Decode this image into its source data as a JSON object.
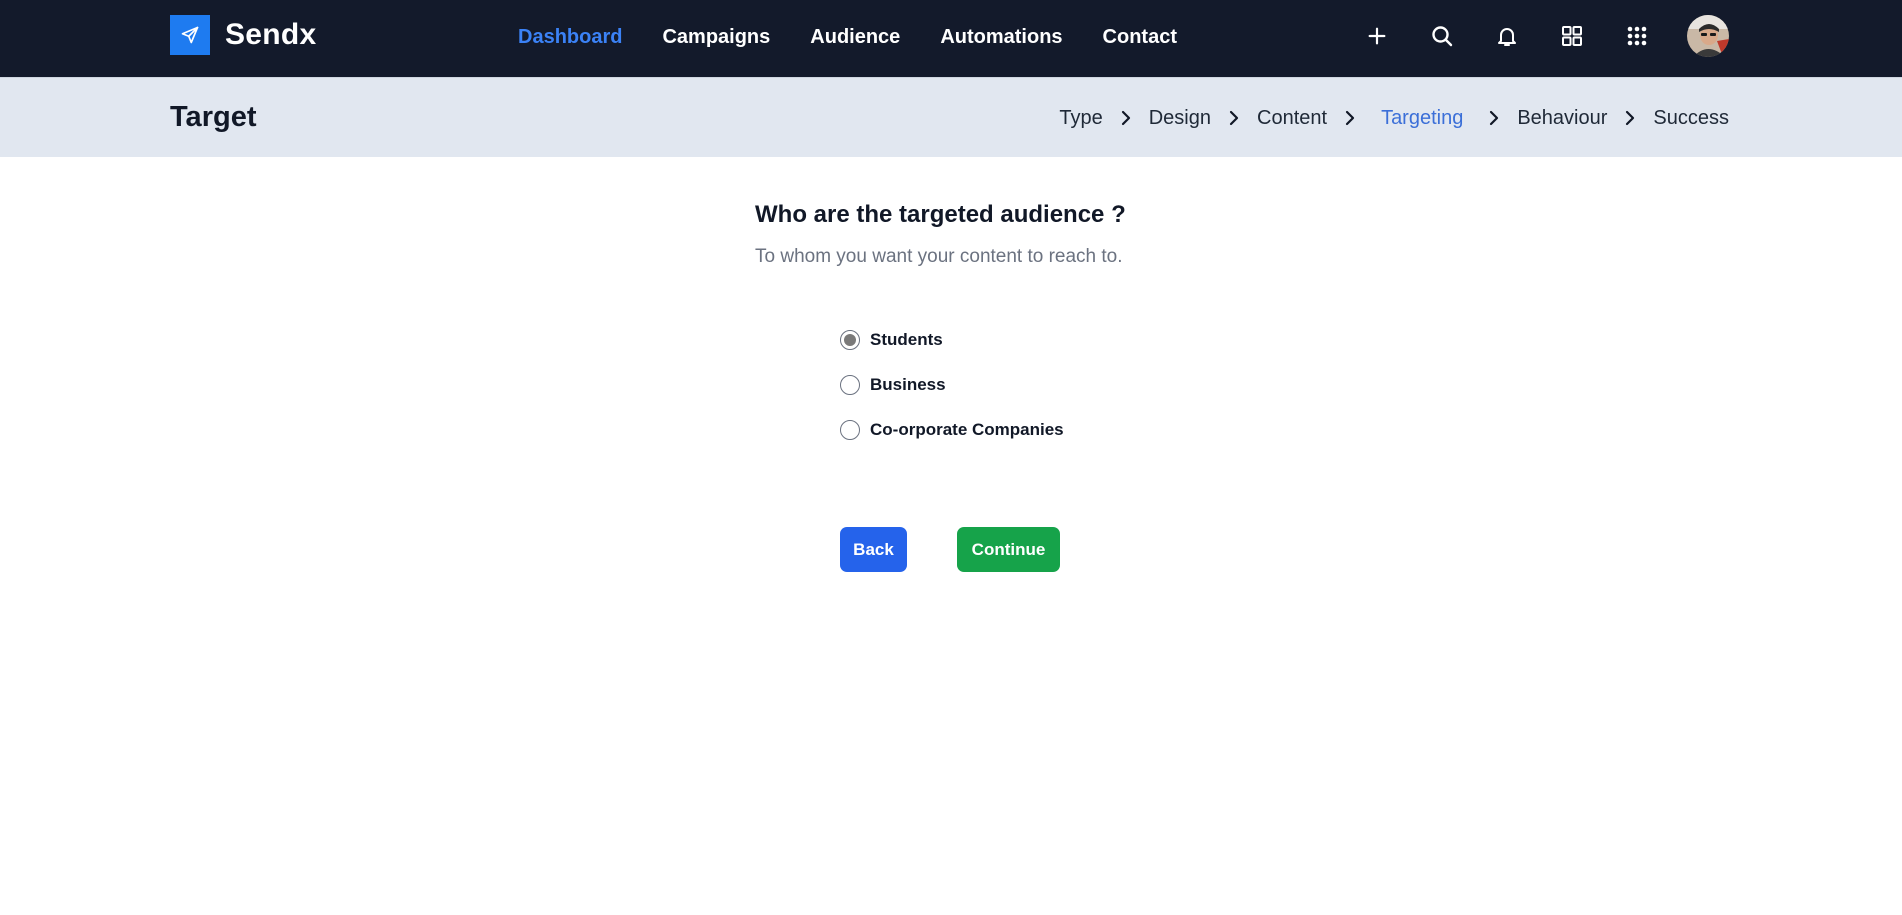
{
  "brand": {
    "name": "Sendx",
    "logo_icon": "paper-plane-icon",
    "logo_color": "#1e7bf0"
  },
  "nav": {
    "links": [
      {
        "label": "Dashboard",
        "active": true
      },
      {
        "label": "Campaigns",
        "active": false
      },
      {
        "label": "Audience",
        "active": false
      },
      {
        "label": "Automations",
        "active": false
      },
      {
        "label": "Contact",
        "active": false
      }
    ],
    "icons": [
      "plus-icon",
      "search-icon",
      "bell-icon",
      "grid-icon",
      "apps-icon"
    ],
    "accent_color": "#3b82f6"
  },
  "subheader": {
    "title": "Target",
    "steps": [
      {
        "label": "Type",
        "active": false
      },
      {
        "label": "Design",
        "active": false
      },
      {
        "label": "Content",
        "active": false
      },
      {
        "label": "Targeting",
        "active": true
      },
      {
        "label": "Behaviour",
        "active": false
      },
      {
        "label": "Success",
        "active": false
      }
    ]
  },
  "main": {
    "question": "Who are the targeted audience ?",
    "subtitle": "To whom you want your content to reach to.",
    "options": [
      {
        "label": "Students",
        "checked": true
      },
      {
        "label": "Business",
        "checked": false
      },
      {
        "label": "Co-orporate Companies",
        "checked": false
      }
    ],
    "back_label": "Back",
    "continue_label": "Continue",
    "back_color": "#2563eb",
    "continue_color": "#16a34a"
  }
}
